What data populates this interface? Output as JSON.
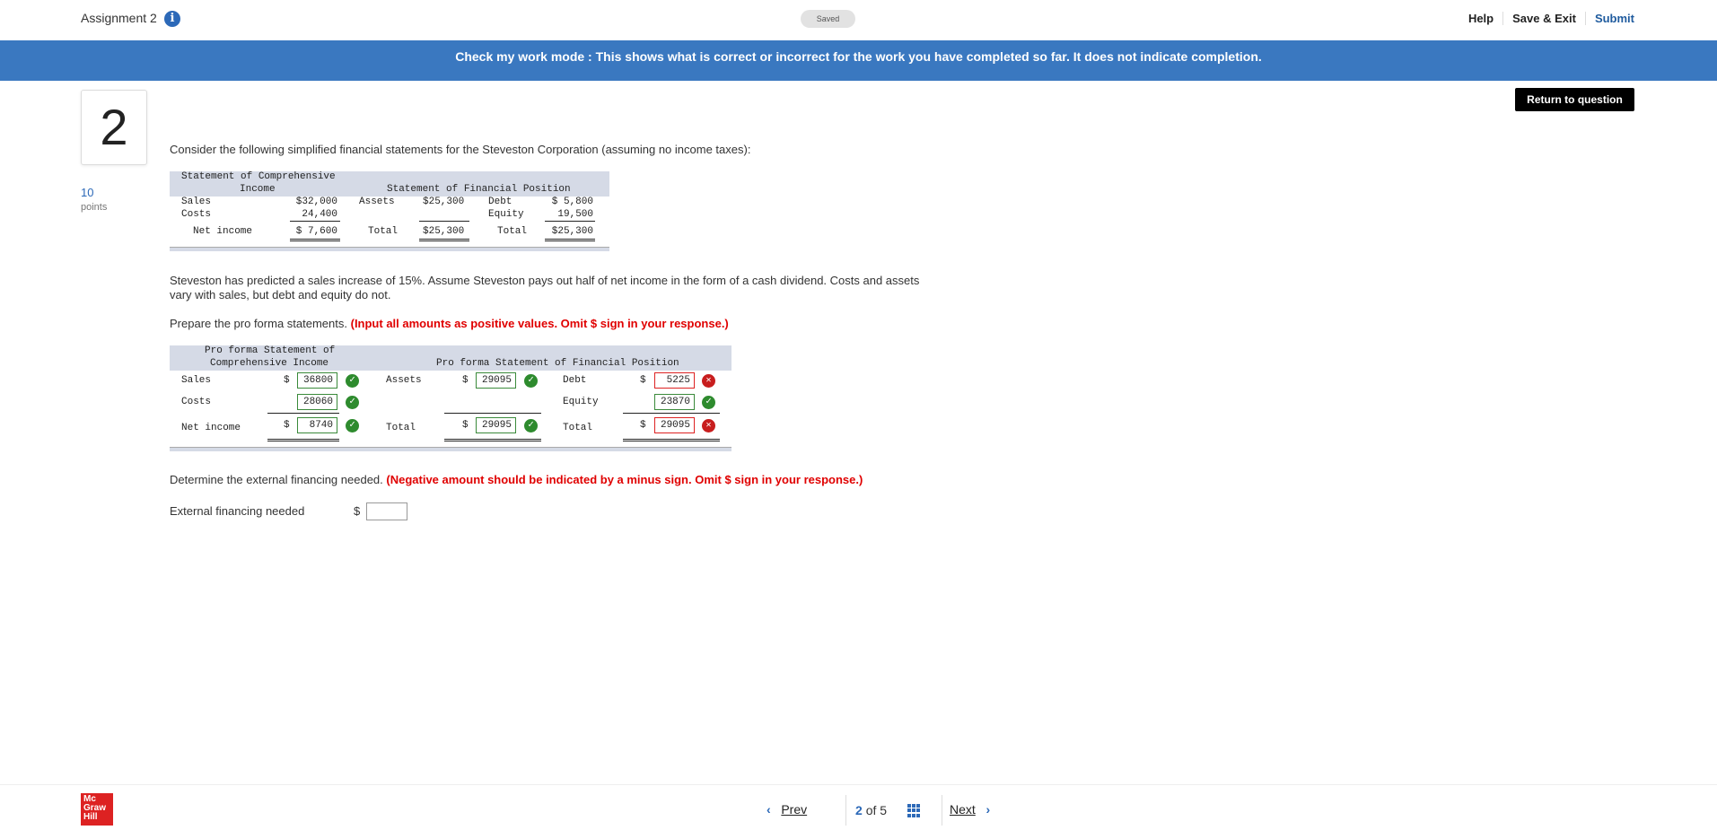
{
  "header": {
    "assignment_title": "Assignment 2",
    "info_icon": "info-icon",
    "saved_label": "Saved",
    "help_label": "Help",
    "save_exit_label": "Save & Exit",
    "submit_label": "Submit"
  },
  "banner": {
    "text": "Check my work mode : This shows what is correct or incorrect for the work you have completed so far. It does not indicate completion."
  },
  "question": {
    "number": "2",
    "points_value": "10",
    "points_label": "points",
    "return_button": "Return to question",
    "intro": "Consider the following simplified financial statements for the Steveston Corporation (assuming no income taxes):",
    "paragraph1": "Steveston has predicted a sales increase of 15%. Assume Steveston pays out half of net income in the form of a cash dividend. Costs and assets vary with sales, but debt and equity do not.",
    "prepare_text": "Prepare the pro forma statements.",
    "prepare_instruction": "(Input all amounts as positive values. Omit $ sign in your response.)",
    "determine_text": "Determine the external financing needed.",
    "determine_instruction": "(Negative amount should be indicated by a minus sign. Omit $ sign in your response.)",
    "efn_label": "External financing needed",
    "efn_dollar": "$",
    "efn_value": ""
  },
  "statement": {
    "income_header_1": "Statement of Comprehensive",
    "income_header_2": "Income",
    "position_header": "Statement of Financial Position",
    "sales_label": "Sales",
    "sales_value": "$32,000",
    "costs_label": "Costs",
    "costs_value": "24,400",
    "net_income_label": "Net income",
    "net_income_value": "$ 7,600",
    "assets_label": "Assets",
    "assets_value": "$25,300",
    "total_label": "Total",
    "total_assets_value": "$25,300",
    "debt_label": "Debt",
    "debt_value": "$ 5,800",
    "equity_label": "Equity",
    "equity_value": "19,500",
    "total_label_2": "Total",
    "total_liab_value": "$25,300"
  },
  "pro_forma": {
    "income_header_1": "Pro forma Statement of",
    "income_header_2": "Comprehensive Income",
    "position_header": "Pro forma Statement of Financial Position",
    "sales_label": "Sales",
    "sales_value": "36800",
    "costs_label": "Costs",
    "costs_value": "28060",
    "net_income_label": "Net income",
    "net_income_value": "8740",
    "assets_label": "Assets",
    "assets_value": "29095",
    "total_label": "Total",
    "total_assets_value": "29095",
    "debt_label": "Debt",
    "debt_value": "5225",
    "equity_label": "Equity",
    "equity_value": "23870",
    "total_label_2": "Total",
    "total_liab_value": "29095",
    "dollar": "$",
    "status_correct": "correct",
    "status_incorrect": "incorrect"
  },
  "footer": {
    "logo_text": "Mc Graw Hill",
    "prev_label": "Prev",
    "current": "2",
    "of_label": "of 5",
    "next_label": "Next"
  },
  "colors": {
    "banner": "#3a78c0",
    "correct": "#2e8b2e",
    "incorrect": "#c81e1e",
    "instruction": "#e00000"
  }
}
